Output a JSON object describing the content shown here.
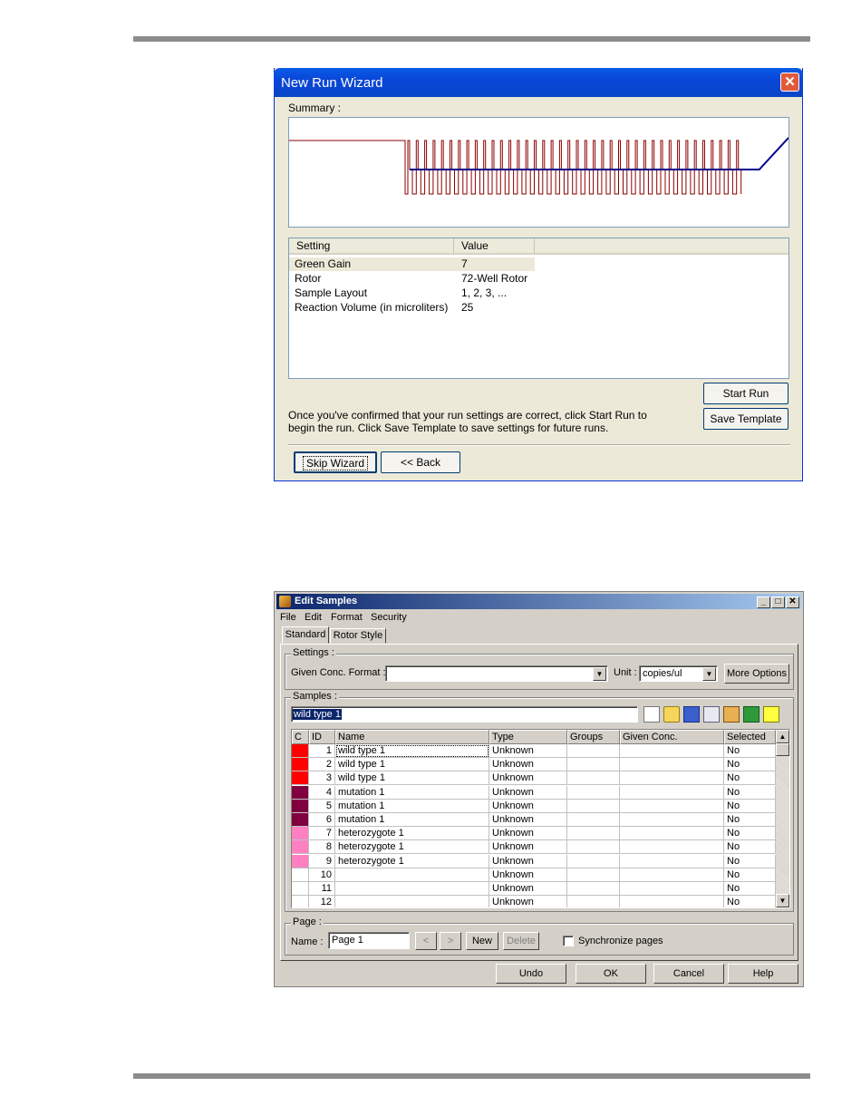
{
  "wizard": {
    "title": "New Run Wizard",
    "close_icon": "close-icon",
    "summary_label": "Summary :",
    "table_headers": [
      "Setting",
      "Value"
    ],
    "rows": [
      {
        "setting": "Green Gain",
        "value": "7"
      },
      {
        "setting": "Rotor",
        "value": "72-Well Rotor"
      },
      {
        "setting": "Sample Layout",
        "value": "1, 2, 3, ..."
      },
      {
        "setting": "Reaction Volume (in microliters)",
        "value": "25"
      }
    ],
    "message_line1": "Once you've confirmed that your run settings are correct, click Start Run to",
    "message_line2": "begin the run. Click Save Template to save settings for future runs.",
    "start_run": "Start Run",
    "save_template": "Save Template",
    "skip_wizard": "Skip Wizard",
    "back": "<< Back",
    "profile_cycles": 40,
    "colors": {
      "profile": "#8b0000",
      "acquisition": "#00008b",
      "selected_row": "#ece9d8"
    }
  },
  "edit": {
    "title": "Edit Samples",
    "app_icon": "samples-icon",
    "menu": [
      "File",
      "Edit",
      "Format",
      "Security"
    ],
    "tabs": [
      "Standard",
      "Rotor Style"
    ],
    "settings_label": "Settings :",
    "given_conc_label": "Given Conc. Format :",
    "given_conc_value": "",
    "unit_label": "Unit :",
    "unit_value": "copies/ul",
    "more_options": "More Options",
    "samples_label": "Samples :",
    "sample_edit_value": "wild type 1",
    "toolbar_icons": [
      "new-icon",
      "open-icon",
      "save-icon",
      "copy-icon",
      "paste-icon",
      "excel-icon",
      "highlight-icon"
    ],
    "columns": [
      "C",
      "ID",
      "Name",
      "Type",
      "Groups",
      "Given Conc.",
      "Selected"
    ],
    "rows": [
      {
        "color": "#ff0000",
        "id": "1",
        "name": "wild type 1",
        "type": "Unknown",
        "groups": "",
        "conc": "",
        "selected": "No"
      },
      {
        "color": "#ff0000",
        "id": "2",
        "name": "wild type 1",
        "type": "Unknown",
        "groups": "",
        "conc": "",
        "selected": "No"
      },
      {
        "color": "#ff0000",
        "id": "3",
        "name": "wild type 1",
        "type": "Unknown",
        "groups": "",
        "conc": "",
        "selected": "No"
      },
      {
        "color": "#800040",
        "id": "4",
        "name": "mutation 1",
        "type": "Unknown",
        "groups": "",
        "conc": "",
        "selected": "No"
      },
      {
        "color": "#800040",
        "id": "5",
        "name": "mutation 1",
        "type": "Unknown",
        "groups": "",
        "conc": "",
        "selected": "No"
      },
      {
        "color": "#800040",
        "id": "6",
        "name": "mutation 1",
        "type": "Unknown",
        "groups": "",
        "conc": "",
        "selected": "No"
      },
      {
        "color": "#ff80c0",
        "id": "7",
        "name": "heterozygote 1",
        "type": "Unknown",
        "groups": "",
        "conc": "",
        "selected": "No"
      },
      {
        "color": "#ff80c0",
        "id": "8",
        "name": "heterozygote 1",
        "type": "Unknown",
        "groups": "",
        "conc": "",
        "selected": "No"
      },
      {
        "color": "#ff80c0",
        "id": "9",
        "name": "heterozygote 1",
        "type": "Unknown",
        "groups": "",
        "conc": "",
        "selected": "No"
      },
      {
        "color": "#ffffff",
        "id": "10",
        "name": "",
        "type": "Unknown",
        "groups": "",
        "conc": "",
        "selected": "No"
      },
      {
        "color": "#ffffff",
        "id": "11",
        "name": "",
        "type": "Unknown",
        "groups": "",
        "conc": "",
        "selected": "No"
      },
      {
        "color": "#ffffff",
        "id": "12",
        "name": "",
        "type": "Unknown",
        "groups": "",
        "conc": "",
        "selected": "No"
      }
    ],
    "page_label": "Page :",
    "name_label": "Name :",
    "page_name": "Page 1",
    "prev": "<",
    "next": ">",
    "new": "New",
    "delete": "Delete",
    "sync_label": "Synchronize pages",
    "sync_checked": false,
    "undo": "Undo",
    "ok": "OK",
    "cancel": "Cancel",
    "help": "Help"
  }
}
